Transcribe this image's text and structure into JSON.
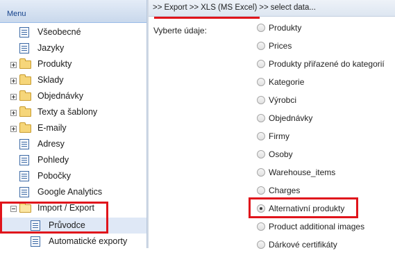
{
  "sidebar": {
    "title": "Menu",
    "items": [
      {
        "label": "Všeobecné",
        "icon": "page-icon",
        "expander": null,
        "selected": false
      },
      {
        "label": "Jazyky",
        "icon": "page-icon",
        "expander": null,
        "selected": false
      },
      {
        "label": "Produkty",
        "icon": "folder-icon",
        "expander": "plus",
        "selected": false
      },
      {
        "label": "Sklady",
        "icon": "folder-icon",
        "expander": "plus",
        "selected": false
      },
      {
        "label": "Objednávky",
        "icon": "folder-icon",
        "expander": "plus",
        "selected": false
      },
      {
        "label": "Texty a šablony",
        "icon": "folder-icon",
        "expander": "plus",
        "selected": false
      },
      {
        "label": "E-maily",
        "icon": "folder-icon",
        "expander": "plus",
        "selected": false
      },
      {
        "label": "Adresy",
        "icon": "page-icon",
        "expander": null,
        "selected": false
      },
      {
        "label": "Pohledy",
        "icon": "page-icon",
        "expander": null,
        "selected": false
      },
      {
        "label": "Pobočky",
        "icon": "page-icon",
        "expander": null,
        "selected": false
      },
      {
        "label": "Google Analytics",
        "icon": "page-icon",
        "expander": null,
        "selected": false
      },
      {
        "label": "Import / Export",
        "icon": "folder-open-icon",
        "expander": "minus",
        "selected": false
      },
      {
        "label": "Průvodce",
        "icon": "page-icon",
        "expander": null,
        "selected": true
      },
      {
        "label": "Automatické exporty",
        "icon": "page-icon",
        "expander": null,
        "selected": false
      }
    ]
  },
  "breadcrumb": {
    "separator": ">>",
    "items": [
      "Export",
      "XLS (MS Excel)",
      "select data..."
    ]
  },
  "form": {
    "field_label": "Vyberte údaje:",
    "selected_option": "Alternativní produkty",
    "options": [
      "Produkty",
      "Prices",
      "Produkty přiřazené do kategorií",
      "Kategorie",
      "Výrobci",
      "Objednávky",
      "Firmy",
      "Osoby",
      "Warehouse_items",
      "Charges",
      "Alternativní produkty",
      "Product additional images",
      "Dárkové certifikáty"
    ]
  },
  "colors": {
    "annotation": "#e0141b",
    "selected_row": "#dfe8f6",
    "header_text": "#15428b"
  }
}
